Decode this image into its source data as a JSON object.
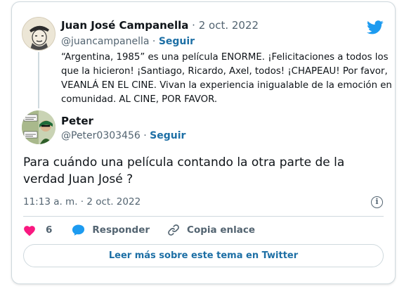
{
  "parent_tweet": {
    "author_name": "Juan José Campanella",
    "separator": "·",
    "date": "2 oct. 2022",
    "handle": "@juancampanella",
    "follow_label": "Seguir",
    "text": "“Argentina, 1985” es una película ENORME. ¡Felicitaciones a todos los que la hicieron! ¡Santiago, Ricardo, Axel, todos! ¡CHAPEAU! Por favor, VEANLÁ EN EL CINE. Vivan la experiencia inigualable de la emoción en comunidad. AL CINE, POR FAVOR."
  },
  "reply_tweet": {
    "author_name": "Peter",
    "handle": "@Peter0303456",
    "separator": "·",
    "follow_label": "Seguir",
    "text": "Para cuándo una película contando la otra parte de la verdad Juan José ?",
    "timestamp": "11:13 a. m. · 2 oct. 2022"
  },
  "actions": {
    "like_count": "6",
    "reply_label": "Responder",
    "copy_label": "Copia enlace"
  },
  "read_more_label": "Leer más sobre este tema en Twitter",
  "info_icon_glyph": "i",
  "colors": {
    "twitter_blue": "#1d9bf0",
    "link_blue": "#1d6fa5",
    "heart": "#f91880",
    "muted": "#536471",
    "border": "#cfd9de"
  },
  "icons": [
    "twitter-bird-icon",
    "info-icon",
    "heart-icon",
    "reply-bubble-icon",
    "link-icon"
  ]
}
